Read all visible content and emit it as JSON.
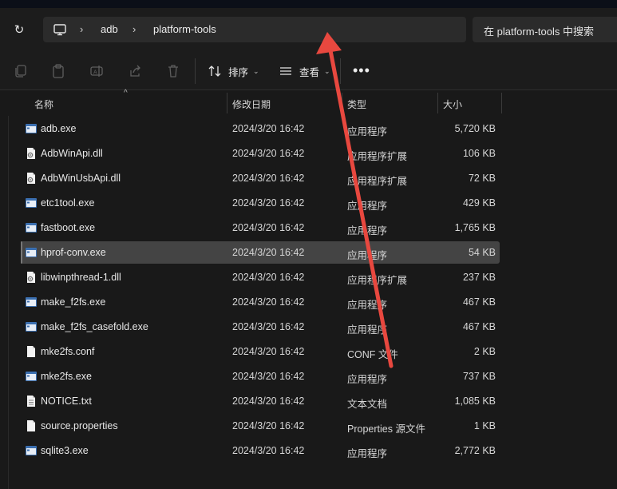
{
  "address": {
    "crumbs": [
      "adb",
      "platform-tools"
    ],
    "search_placeholder": "在 platform-tools 中搜索"
  },
  "toolbar": {
    "sort_label": "排序",
    "view_label": "查看",
    "more_label": "•••"
  },
  "columns": {
    "name": "名称",
    "date": "修改日期",
    "type": "类型",
    "size": "大小"
  },
  "files": [
    {
      "name": "adb.exe",
      "date": "2024/3/20 16:42",
      "type": "应用程序",
      "size": "5,720 KB",
      "icon": "exe-icon"
    },
    {
      "name": "AdbWinApi.dll",
      "date": "2024/3/20 16:42",
      "type": "应用程序扩展",
      "size": "106 KB",
      "icon": "dll-icon"
    },
    {
      "name": "AdbWinUsbApi.dll",
      "date": "2024/3/20 16:42",
      "type": "应用程序扩展",
      "size": "72 KB",
      "icon": "dll-icon"
    },
    {
      "name": "etc1tool.exe",
      "date": "2024/3/20 16:42",
      "type": "应用程序",
      "size": "429 KB",
      "icon": "exe-icon"
    },
    {
      "name": "fastboot.exe",
      "date": "2024/3/20 16:42",
      "type": "应用程序",
      "size": "1,765 KB",
      "icon": "exe-icon"
    },
    {
      "name": "hprof-conv.exe",
      "date": "2024/3/20 16:42",
      "type": "应用程序",
      "size": "54 KB",
      "icon": "exe-icon",
      "selected": true
    },
    {
      "name": "libwinpthread-1.dll",
      "date": "2024/3/20 16:42",
      "type": "应用程序扩展",
      "size": "237 KB",
      "icon": "dll-icon"
    },
    {
      "name": "make_f2fs.exe",
      "date": "2024/3/20 16:42",
      "type": "应用程序",
      "size": "467 KB",
      "icon": "exe-icon"
    },
    {
      "name": "make_f2fs_casefold.exe",
      "date": "2024/3/20 16:42",
      "type": "应用程序",
      "size": "467 KB",
      "icon": "exe-icon"
    },
    {
      "name": "mke2fs.conf",
      "date": "2024/3/20 16:42",
      "type": "CONF 文件",
      "size": "2 KB",
      "icon": "file-icon"
    },
    {
      "name": "mke2fs.exe",
      "date": "2024/3/20 16:42",
      "type": "应用程序",
      "size": "737 KB",
      "icon": "exe-icon"
    },
    {
      "name": "NOTICE.txt",
      "date": "2024/3/20 16:42",
      "type": "文本文档",
      "size": "1,085 KB",
      "icon": "text-file-icon"
    },
    {
      "name": "source.properties",
      "date": "2024/3/20 16:42",
      "type": "Properties 源文件",
      "size": "1 KB",
      "icon": "file-icon"
    },
    {
      "name": "sqlite3.exe",
      "date": "2024/3/20 16:42",
      "type": "应用程序",
      "size": "2,772 KB",
      "icon": "exe-icon"
    }
  ],
  "colors": {
    "background": "#191919",
    "toolbar": "#1c1c1c",
    "selected_row": "#444444",
    "annotation_arrow": "#e8483f"
  }
}
